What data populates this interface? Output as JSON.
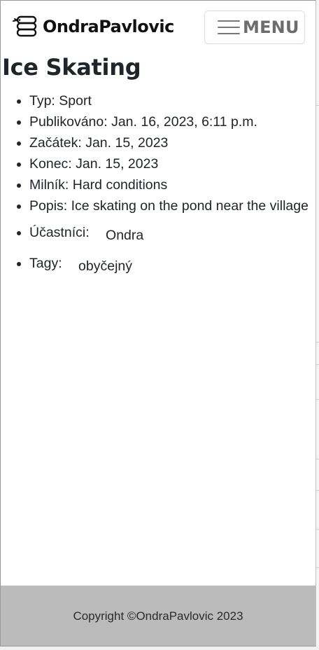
{
  "navbar": {
    "brand_text": "OndraPavlovic",
    "brand_icon": "snake-logo-icon",
    "menu_label": "MENU",
    "menu_icon": "hamburger-icon"
  },
  "main": {
    "title": "Ice Skating",
    "details": {
      "type": "Typ: Sport",
      "published": "Publikováno: Jan. 16, 2023, 6:11 p.m.",
      "start": "Začátek: Jan. 15, 2023",
      "end": "Konec: Jan. 15, 2023",
      "milestone": "Milník: Hard conditions",
      "description": "Popis: Ice skating on the pond near the village",
      "participants_label": "Účastníci:",
      "participants": [
        "Ondra"
      ],
      "tags_label": "Tagy:",
      "tags": [
        "obyčejný"
      ]
    }
  },
  "footer": {
    "copyright": "Copyright ©OndraPavlovic 2023"
  },
  "colors": {
    "footer_bg": "#bbbbbb",
    "text": "#212529",
    "menu_text": "#6c6c6c"
  }
}
